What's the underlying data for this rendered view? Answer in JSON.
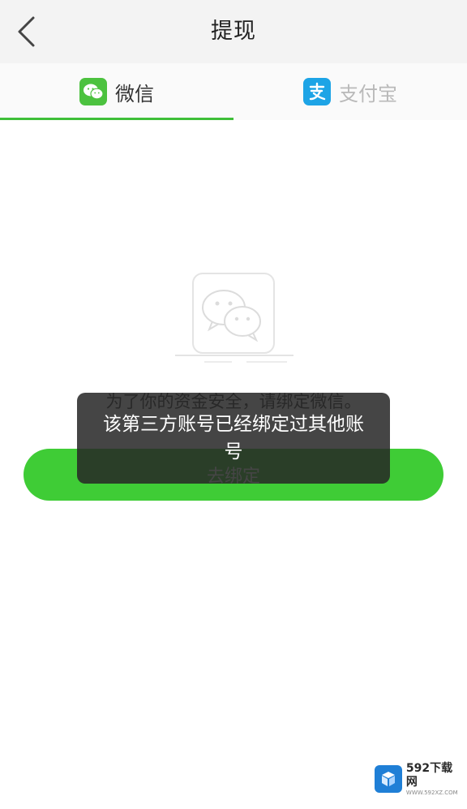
{
  "header": {
    "title": "提现",
    "back_icon": "chevron-left-icon"
  },
  "tabs": [
    {
      "label": "微信",
      "icon": "wechat-icon",
      "selected": true
    },
    {
      "label": "支付宝",
      "icon": "alipay-icon",
      "selected": false
    }
  ],
  "main": {
    "placeholder_icon": "wechat-outline-icon",
    "hint": "为了你的资金安全，请绑定微信。",
    "bind_button_label": "去绑定"
  },
  "toast": {
    "message": "该第三方账号已经绑定过其他账号"
  },
  "watermark": {
    "brand": "592下载网",
    "url": "WWW.592XZ.COM"
  },
  "colors": {
    "accent": "#3fcc36",
    "tab_indicator": "#3fbf39",
    "wechat": "#4cc23f",
    "alipay": "#1da4e6",
    "header_bg": "#f3f3f3",
    "toast_bg": "#262626"
  }
}
